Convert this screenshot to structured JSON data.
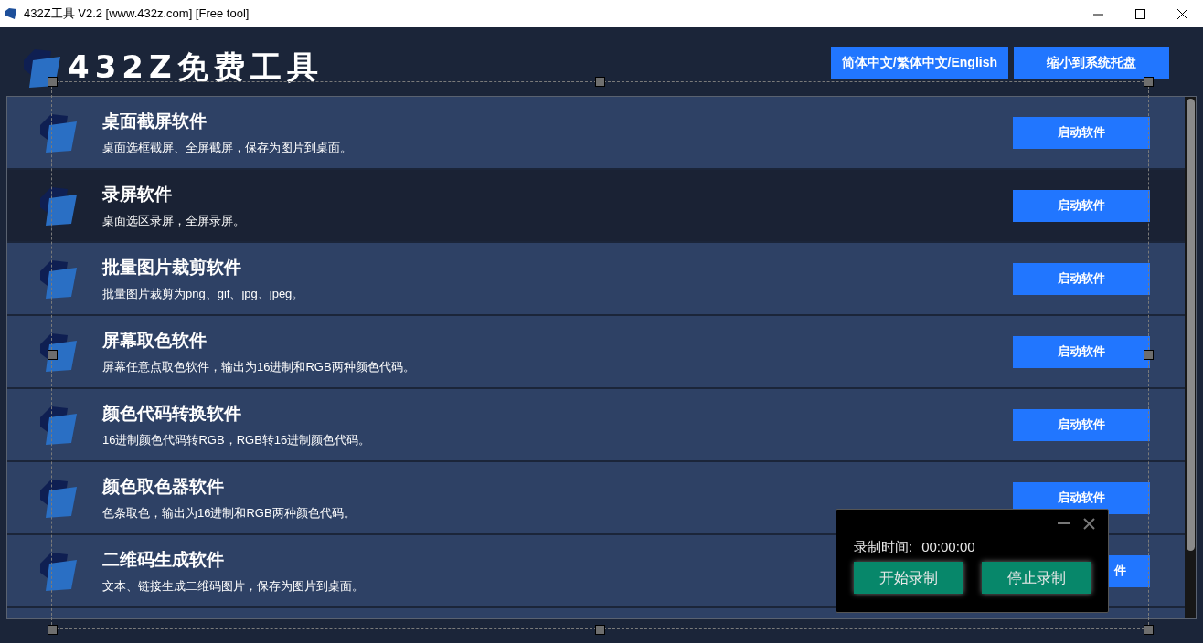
{
  "window": {
    "title": "432Z工具 V2.2 [www.432z.com] [Free tool]"
  },
  "header": {
    "logo_text": "432Z免费工具",
    "buttons": [
      "简体中文/繁体中文/English",
      "缩小到系统托盘"
    ]
  },
  "tools": [
    {
      "name": "桌面截屏软件",
      "description": "桌面选框截屏、全屏截屏，保存为图片到桌面。",
      "button": "启动软件",
      "selected": false,
      "covered": false
    },
    {
      "name": "录屏软件",
      "description": "桌面选区录屏，全屏录屏。",
      "button": "启动软件",
      "selected": true,
      "covered": false
    },
    {
      "name": "批量图片裁剪软件",
      "description": "批量图片裁剪为png、gif、jpg、jpeg。",
      "button": "启动软件",
      "selected": false,
      "covered": false
    },
    {
      "name": "屏幕取色软件",
      "description": "屏幕任意点取色软件，输出为16进制和RGB两种颜色代码。",
      "button": "启动软件",
      "selected": false,
      "covered": false
    },
    {
      "name": "颜色代码转换软件",
      "description": "16进制颜色代码转RGB，RGB转16进制颜色代码。",
      "button": "启动软件",
      "selected": false,
      "covered": false
    },
    {
      "name": "颜色取色器软件",
      "description": "色条取色，输出为16进制和RGB两种颜色代码。",
      "button": "启动软件",
      "selected": false,
      "covered": false
    },
    {
      "name": "二维码生成软件",
      "description": "文本、链接生成二维码图片，保存为图片到桌面。",
      "button": "件",
      "selected": false,
      "covered": true
    }
  ],
  "recorder": {
    "time_label": "录制时间:",
    "time": "00:00:00",
    "buttons": [
      "开始录制",
      "停止录制"
    ]
  }
}
